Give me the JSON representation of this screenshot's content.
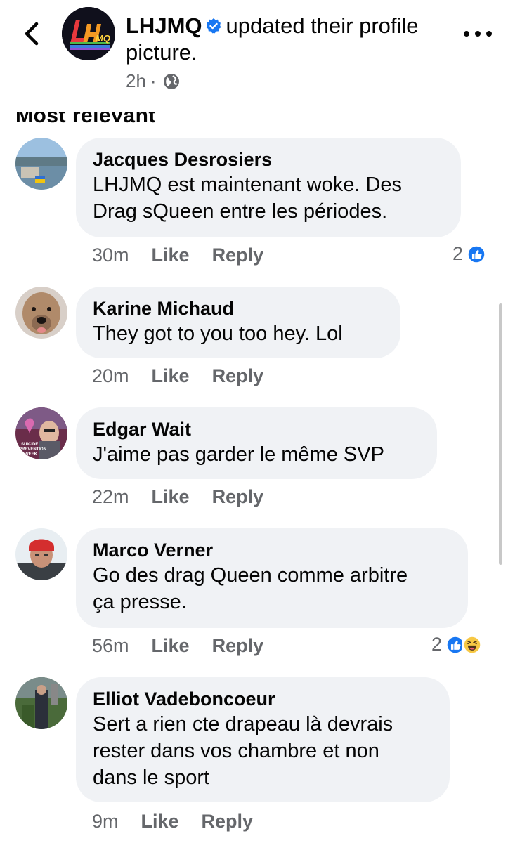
{
  "header": {
    "page_name": "LHJMQ",
    "action_text": "updated their profile picture.",
    "time": "2h",
    "separator": "·",
    "avatar_text": "LHJMQ"
  },
  "section_partial": "Most relevant",
  "comments": [
    {
      "name": "Jacques Desrosiers",
      "lines": [
        "LHJMQ est maintenant woke. Des",
        "Drag sQueen entre les périodes."
      ],
      "time": "30m",
      "like": "Like",
      "reply": "Reply",
      "reaction_count": "2",
      "reactions": [
        "like"
      ]
    },
    {
      "name": "Karine Michaud",
      "lines": [
        "They got to you too hey.  Lol"
      ],
      "time": "20m",
      "like": "Like",
      "reply": "Reply"
    },
    {
      "name": "Edgar Wait",
      "lines": [
        "J'aime pas garder le même SVP"
      ],
      "time": "22m",
      "like": "Like",
      "reply": "Reply",
      "avatar_caption": "SUICIDE PREVENTION WEEK"
    },
    {
      "name": "Marco Verner",
      "lines": [
        "Go des drag Queen comme arbitre",
        "ça presse."
      ],
      "time": "56m",
      "like": "Like",
      "reply": "Reply",
      "reaction_count": "2",
      "reactions": [
        "like",
        "haha"
      ]
    },
    {
      "name": "Elliot Vadeboncoeur",
      "lines": [
        "Sert a rien cte drapeau là devrais",
        "rester dans vos chambre et non",
        "dans le sport"
      ],
      "time": "9m",
      "like": "Like",
      "reply": "Reply"
    }
  ],
  "colors": {
    "bubble": "#f0f2f5",
    "meta_text": "#65676b",
    "like_blue": "#1877f2",
    "haha_yellow": "#f7c844"
  }
}
